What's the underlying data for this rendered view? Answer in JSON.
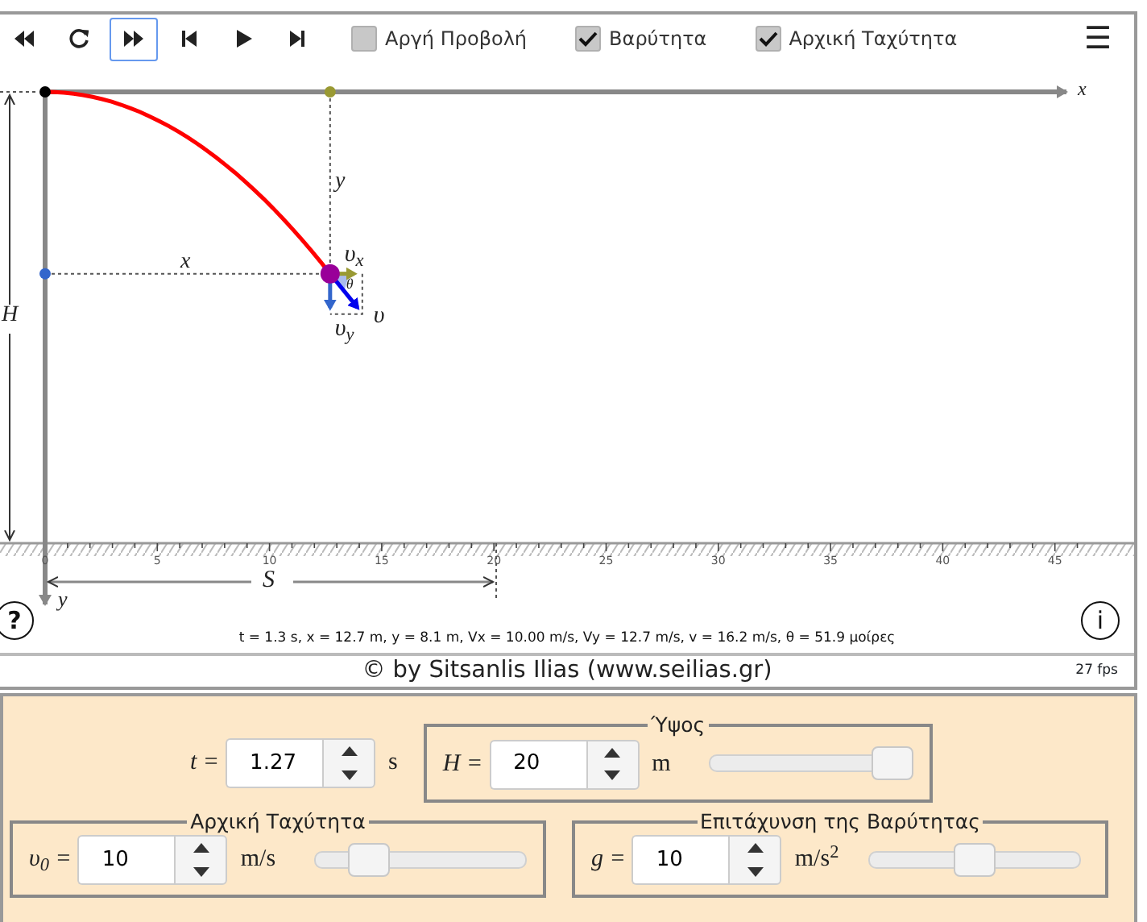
{
  "toolbar": {
    "buttons": [
      {
        "kind": "rewind",
        "selected": false
      },
      {
        "kind": "reload",
        "selected": false
      },
      {
        "kind": "fast_forward",
        "selected": true
      },
      {
        "kind": "step_back",
        "selected": false
      },
      {
        "kind": "play",
        "selected": false
      },
      {
        "kind": "step_forward",
        "selected": false
      }
    ],
    "checkboxes": [
      {
        "label": "Αργή Προβολή",
        "checked": false
      },
      {
        "label": "Βαρύτητα",
        "checked": true
      },
      {
        "label": "Αρχική Ταχύτητα",
        "checked": true
      }
    ],
    "menu_button": "☰"
  },
  "simulation": {
    "axis_labels": {
      "x": "x",
      "y": "y",
      "height": "H",
      "range": "S"
    },
    "position_labels": {
      "x": "x",
      "y": "y"
    },
    "vector_labels": {
      "vx": "υ$_{x}$",
      "vy": "υ$_{y}$",
      "v": "υ",
      "angle": "θ"
    },
    "ticks": [
      "0",
      "5",
      "10",
      "15",
      "20",
      "25",
      "30",
      "35",
      "40",
      "45"
    ],
    "readout": "t = 1.3 s, x = 12.7 m, y = 8.1 m, Vx = 10.00 m/s, Vy = 12.7 m/s, v = 16.2 m/s, θ = 51.9 μοίρες",
    "help_button": "?",
    "info_button": "i"
  },
  "footer": {
    "credit": "© by Sitsanlis Ilias (www.seilias.gr)",
    "fps": "27 fps"
  },
  "controls": {
    "time": {
      "label": "t =",
      "value": "1.27",
      "unit": "s"
    },
    "height": {
      "legend": "Ύψος",
      "label": "H =",
      "value": "20",
      "unit": "m",
      "level": 1
    },
    "initial_speed": {
      "legend": "Αρχική Ταχύτητα",
      "label": "υ$_{0}$ =",
      "value": "10",
      "unit": "m/s",
      "level": 0.2
    },
    "gravity": {
      "legend": "Επιτάχυνση της Βαρύτητας",
      "label": "g =",
      "value": "10",
      "unit": "m/s$^{2}$",
      "level": 0.5
    }
  }
}
